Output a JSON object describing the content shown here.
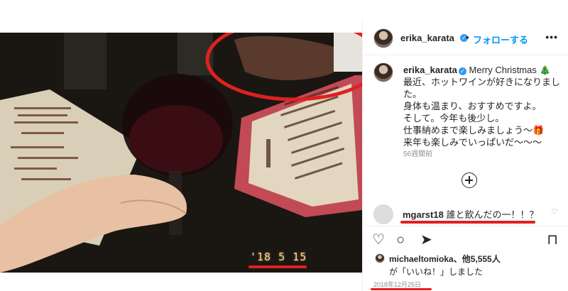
{
  "photo": {
    "date_stamp": "'18 5 15"
  },
  "header": {
    "username": "erika_karata",
    "dot": "•",
    "follow_label": "フォローする",
    "more_icon": "•••"
  },
  "caption": {
    "username": "erika_karata",
    "lines": [
      "Merry Christmas 🎄",
      "最近、ホットワインが好きになりまし",
      "た。",
      "身体も温まり、おすすめですよ。",
      "そして。今年も後少し。",
      "仕事納めまで楽しみましょう〜🎁",
      "来年も楽しみでいっぱいだ〜〜〜"
    ],
    "time_ago": "56週間前"
  },
  "load_more_icon": "plus-circle-icon",
  "comment": {
    "username": "mgarst18",
    "text": "誰と飲んだの一！！？"
  },
  "actions": {
    "like_icon": "♡",
    "comment_icon": "○",
    "share_icon": "➤",
    "save_icon": "⊓"
  },
  "likes": {
    "line1": "michaeltomioka、他5,555人",
    "line2": "が「いいね！」しました"
  },
  "post_date": "2018年12月25日",
  "colors": {
    "accent": "#0095f6",
    "annotation": "#e02020",
    "verified": "#3897f0"
  }
}
